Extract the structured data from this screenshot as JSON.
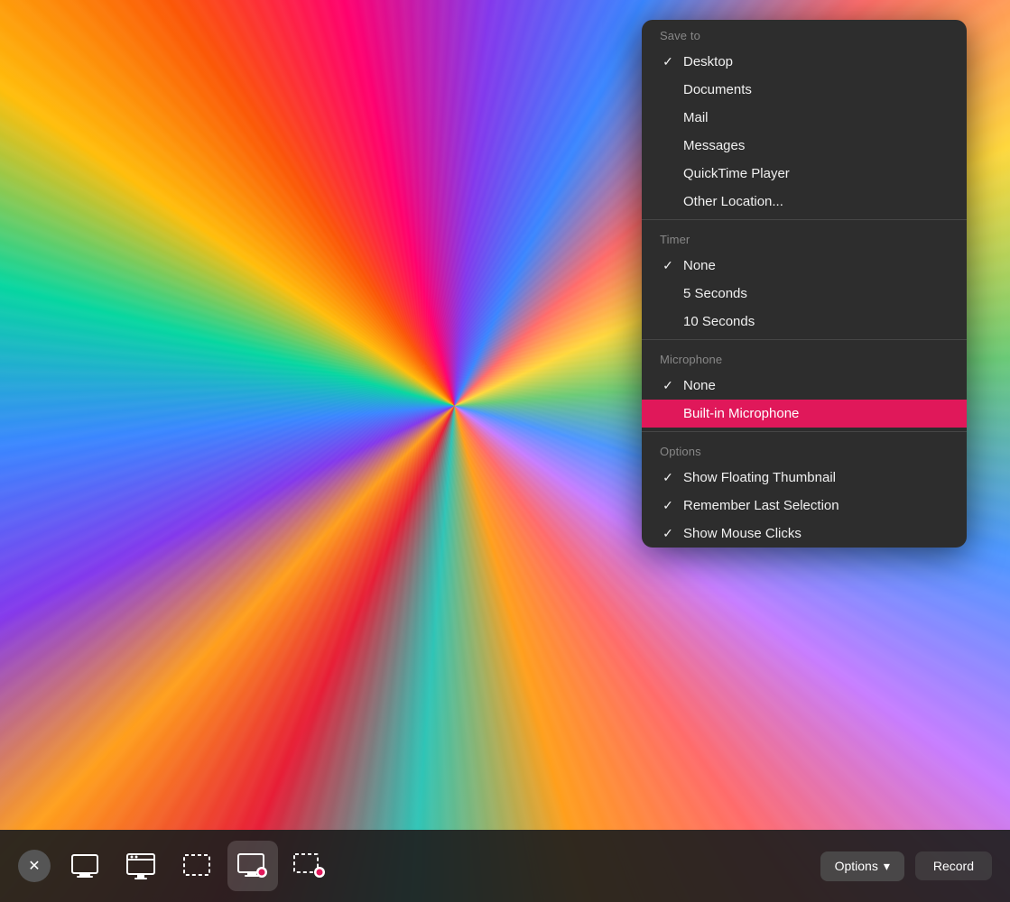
{
  "background": {
    "description": "Colorful starburst wallpaper"
  },
  "menu": {
    "save_to_label": "Save to",
    "items_save": [
      {
        "id": "desktop",
        "label": "Desktop",
        "checked": true
      },
      {
        "id": "documents",
        "label": "Documents",
        "checked": false
      },
      {
        "id": "mail",
        "label": "Mail",
        "checked": false
      },
      {
        "id": "messages",
        "label": "Messages",
        "checked": false
      },
      {
        "id": "quicktime",
        "label": "QuickTime Player",
        "checked": false
      },
      {
        "id": "other",
        "label": "Other Location...",
        "checked": false
      }
    ],
    "timer_label": "Timer",
    "items_timer": [
      {
        "id": "none",
        "label": "None",
        "checked": true
      },
      {
        "id": "5sec",
        "label": "5 Seconds",
        "checked": false
      },
      {
        "id": "10sec",
        "label": "10 Seconds",
        "checked": false
      }
    ],
    "microphone_label": "Microphone",
    "items_microphone": [
      {
        "id": "mic-none",
        "label": "None",
        "checked": true,
        "highlighted": false
      },
      {
        "id": "builtin-mic",
        "label": "Built-in Microphone",
        "checked": false,
        "highlighted": true
      }
    ],
    "options_label": "Options",
    "items_options": [
      {
        "id": "floating-thumbnail",
        "label": "Show Floating Thumbnail",
        "checked": true
      },
      {
        "id": "remember-selection",
        "label": "Remember Last Selection",
        "checked": true
      },
      {
        "id": "show-clicks",
        "label": "Show Mouse Clicks",
        "checked": true
      }
    ]
  },
  "toolbar": {
    "close_label": "✕",
    "options_label": "Options",
    "options_chevron": "▾",
    "record_label": "Record",
    "tools": [
      {
        "id": "fullscreen",
        "label": "Capture Entire Screen"
      },
      {
        "id": "window",
        "label": "Capture Selected Window"
      },
      {
        "id": "selection",
        "label": "Capture Selected Portion"
      },
      {
        "id": "screen-record",
        "label": "Record Entire Screen",
        "active": true
      },
      {
        "id": "portion-record",
        "label": "Record Selected Portion"
      }
    ]
  }
}
